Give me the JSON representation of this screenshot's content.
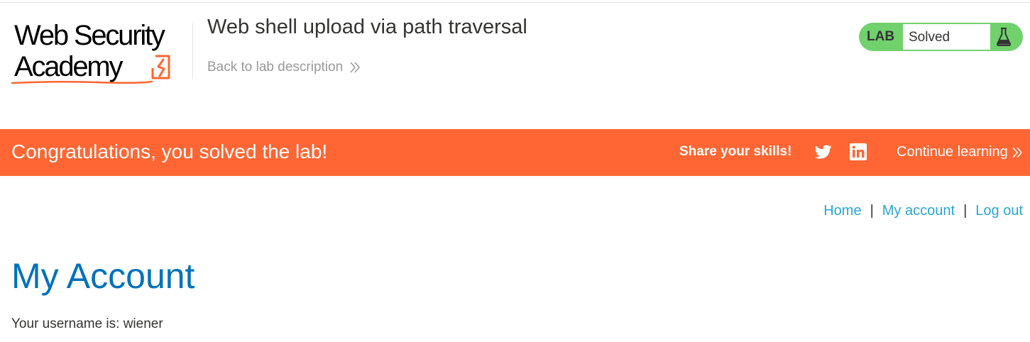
{
  "header": {
    "logo": {
      "line1": "Web Security",
      "line2": "Academy",
      "accent_color": "#ff6633"
    },
    "lab_title": "Web shell upload via path traversal",
    "back_link_label": "Back to lab description",
    "lab_status": {
      "badge": "LAB",
      "status": "Solved",
      "color": "#70d16d",
      "icon": "flask-icon"
    }
  },
  "banner": {
    "message": "Congratulations, you solved the lab!",
    "share_label": "Share your skills!",
    "share_icons": [
      "twitter-icon",
      "linkedin-icon"
    ],
    "continue_label": "Continue learning",
    "color": "#ff6633"
  },
  "nav": {
    "items": [
      {
        "label": "Home"
      },
      {
        "label": "My account"
      },
      {
        "label": "Log out"
      }
    ],
    "separator": "|",
    "link_color": "#29a5d8"
  },
  "main": {
    "heading": "My Account",
    "username_text": "Your username is: wiener"
  }
}
